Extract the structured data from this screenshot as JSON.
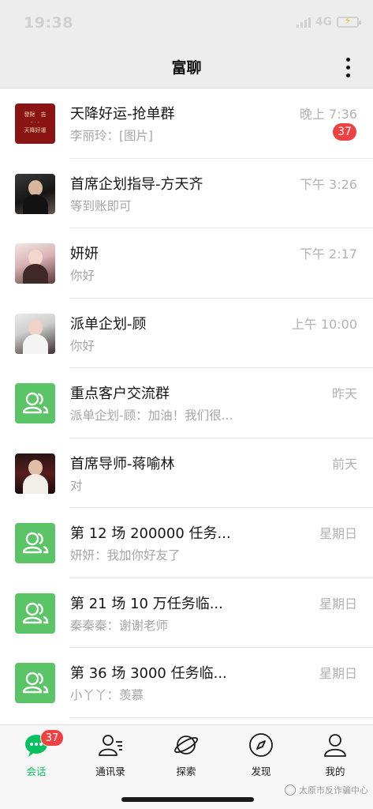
{
  "status_bar": {
    "time": "19:38",
    "network": "4G"
  },
  "nav": {
    "title": "富聊"
  },
  "chats": [
    {
      "name": "天降好运-抢单群",
      "time": "晚上 7:36",
      "preview": "李丽玲：[图片]",
      "unread": "37",
      "avatar": "group-red"
    },
    {
      "name": "首席企划指导-方天齐",
      "time": "下午 3:26",
      "preview": "等到账即可",
      "avatar": "photo"
    },
    {
      "name": "妍妍",
      "time": "下午 2:17",
      "preview": "你好",
      "avatar": "photo"
    },
    {
      "name": "派单企划-顾",
      "time": "上午 10:00",
      "preview": "你好",
      "avatar": "photo"
    },
    {
      "name": "重点客户交流群",
      "time": "昨天",
      "preview": "派单企划-顾：加油！我们很...",
      "avatar": "group"
    },
    {
      "name": "首席导师-蒋喻林",
      "time": "前天",
      "preview": "对",
      "avatar": "photo"
    },
    {
      "name": "第 12 场 200000 任务...",
      "time": "星期日",
      "preview": "妍妍：我加你好友了",
      "avatar": "group"
    },
    {
      "name": "第 21 场 10 万任务临...",
      "time": "星期日",
      "preview": "秦秦秦：谢谢老师",
      "avatar": "group"
    },
    {
      "name": "第 36 场 3000 任务临...",
      "time": "星期日",
      "preview": "小丫丫：羡慕",
      "avatar": "group"
    }
  ],
  "tabs": [
    {
      "label": "会话",
      "badge": "37",
      "icon": "chat-bubble-icon"
    },
    {
      "label": "通讯录",
      "icon": "contacts-icon"
    },
    {
      "label": "探索",
      "icon": "planet-icon"
    },
    {
      "label": "发现",
      "icon": "compass-icon"
    },
    {
      "label": "我的",
      "icon": "person-icon"
    }
  ],
  "watermark": "太原市反诈骗中心",
  "colors": {
    "accent_green": "#07c160",
    "badge_red": "#f04142",
    "group_avatar": "#5bc466"
  }
}
